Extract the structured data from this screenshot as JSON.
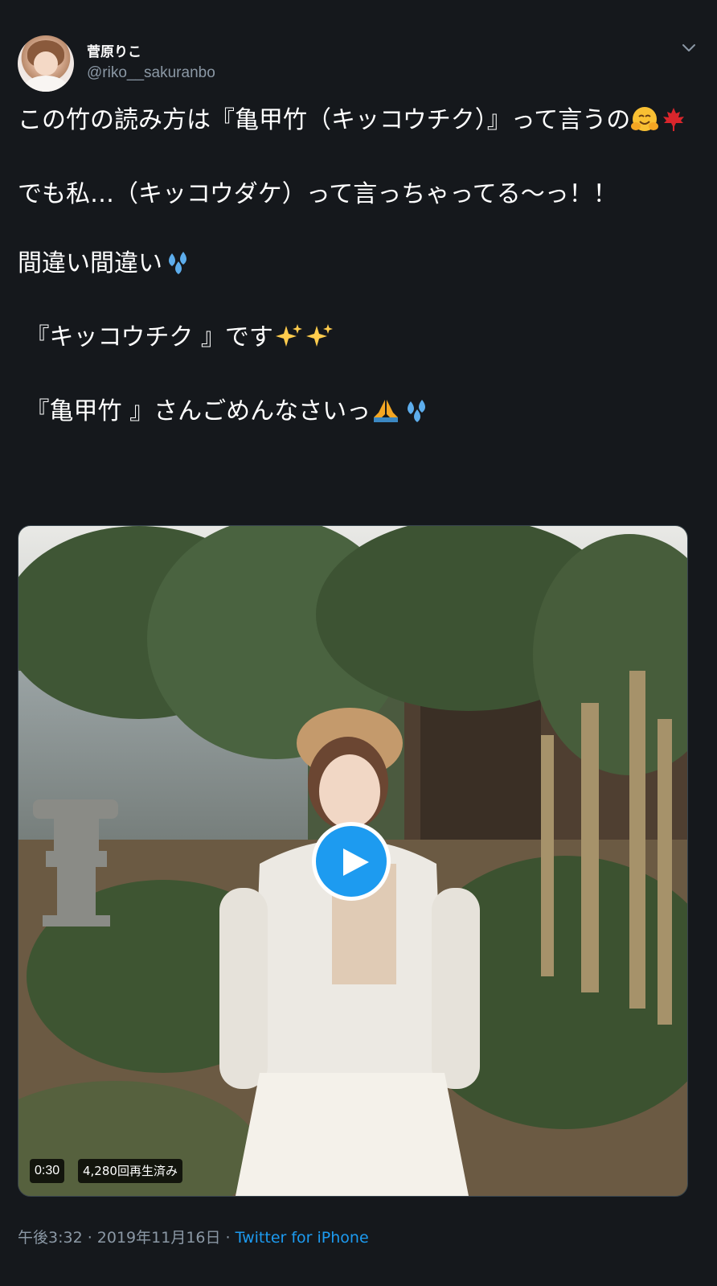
{
  "author": {
    "display_name": "菅原りこ",
    "handle": "@riko__sakuranbo"
  },
  "tweet": {
    "paragraphs": [
      {
        "text": "この竹の読み方は『亀甲竹（キッコウチク）』って言うの",
        "emojis": [
          "hugging-face",
          "maple-leaf"
        ]
      },
      {
        "text": "でも私…（キッコウダケ）って言っちゃってる〜っ！！",
        "emojis": []
      },
      {
        "text": "間違い間違い",
        "emojis": [
          "sweat-droplets"
        ]
      },
      {
        "text": " 『キッコウチク 』です",
        "emojis": [
          "sparkles",
          "sparkles"
        ]
      },
      {
        "text": " 『亀甲竹 』さんごめんなさいっ",
        "emojis": [
          "folded-hands",
          "sweat-droplets"
        ]
      }
    ]
  },
  "video": {
    "duration": "0:30",
    "views": "4,280回再生済み"
  },
  "meta": {
    "time": "午後3:32",
    "separator": " · ",
    "date": "2019年11月16日",
    "source": "Twitter for iPhone"
  },
  "colors": {
    "background": "#15181c",
    "text": "#ffffff",
    "secondary": "#8b98a5",
    "accent": "#1d9bf0"
  }
}
